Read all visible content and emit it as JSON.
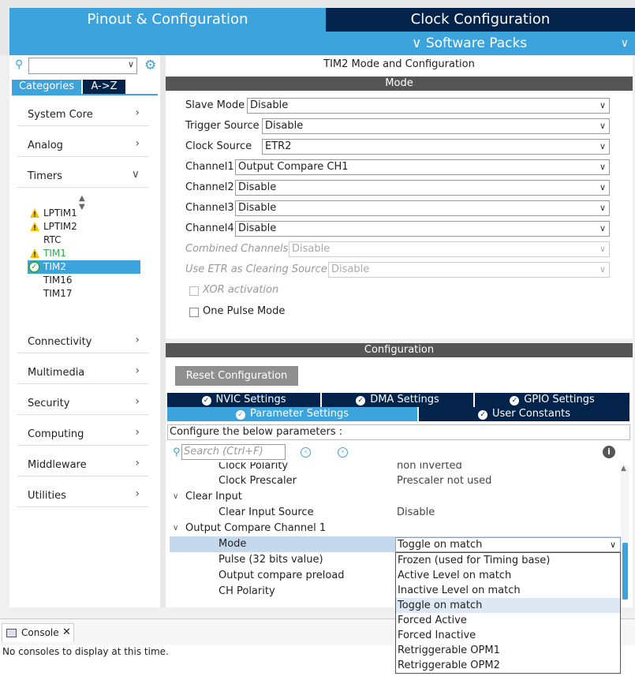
{
  "header": {
    "tab_pinout": "Pinout & Configuration",
    "tab_clock": "Clock Configuration",
    "software_packs": "Software Packs"
  },
  "sidebar": {
    "search_placeholder": "",
    "tab_categories": "Categories",
    "tab_az": "A->Z",
    "categories_top": [
      "System Core",
      "Analog",
      "Timers"
    ],
    "timers": [
      {
        "label": "LPTIM1",
        "status": "warning"
      },
      {
        "label": "LPTIM2",
        "status": "warning"
      },
      {
        "label": "RTC",
        "status": "none"
      },
      {
        "label": "TIM1",
        "status": "warning"
      },
      {
        "label": "TIM2",
        "status": "ok",
        "selected": true
      },
      {
        "label": "TIM16",
        "status": "none"
      },
      {
        "label": "TIM17",
        "status": "none"
      }
    ],
    "categories_bottom": [
      "Connectivity",
      "Multimedia",
      "Security",
      "Computing",
      "Middleware",
      "Utilities"
    ]
  },
  "mode_panel": {
    "title": "TIM2 Mode and Configuration",
    "section": "Mode",
    "fields": [
      {
        "label": "Slave Mode",
        "value": "Disable"
      },
      {
        "label": "Trigger Source",
        "value": "Disable"
      },
      {
        "label": "Clock Source",
        "value": "ETR2"
      },
      {
        "label": "Channel1",
        "value": "Output Compare CH1"
      },
      {
        "label": "Channel2",
        "value": "Disable"
      },
      {
        "label": "Channel3",
        "value": "Disable"
      },
      {
        "label": "Channel4",
        "value": "Disable"
      },
      {
        "label": "Combined Channels",
        "value": "Disable",
        "disabled": true
      },
      {
        "label": "Use ETR as Clearing Source",
        "value": "Disable",
        "disabled": true
      }
    ],
    "xor_activation": "XOR activation",
    "one_pulse_mode": "One Pulse Mode"
  },
  "config_panel": {
    "section": "Configuration",
    "reset_button": "Reset Configuration",
    "tabs_row1": [
      "NVIC Settings",
      "DMA Settings",
      "GPIO Settings"
    ],
    "tabs_row2": [
      "Parameter Settings",
      "User Constants"
    ],
    "configure_text": "Configure the below parameters :",
    "search_placeholder": "Search (Ctrl+F)",
    "params": [
      {
        "key": "Clock Polarity",
        "value": "non inverted"
      },
      {
        "key": "Clock Prescaler",
        "value": "Prescaler not used"
      },
      {
        "group": "Clear Input"
      },
      {
        "key": "Clear Input Source",
        "value": "Disable"
      },
      {
        "group": "Output Compare Channel 1"
      },
      {
        "key": "Mode",
        "value": "Toggle on match"
      },
      {
        "key": "Pulse (32 bits value)",
        "value": ""
      },
      {
        "key": "Output compare preload",
        "value": ""
      },
      {
        "key": "CH Polarity",
        "value": ""
      }
    ],
    "mode_options": [
      "Frozen (used for Timing base)",
      "Active Level on match",
      "Inactive Level on match",
      "Toggle on match",
      "Forced Active",
      "Forced Inactive",
      "Retriggerable OPM1",
      "Retriggerable OPM2"
    ]
  },
  "console": {
    "tab_label": "Console",
    "message": "No consoles to display at this time."
  },
  "colors": {
    "accent_blue": "#3ca3dc",
    "dark_navy": "#03234b",
    "ok_green": "#2fa84f",
    "warn_yellow": "#f5c400"
  }
}
